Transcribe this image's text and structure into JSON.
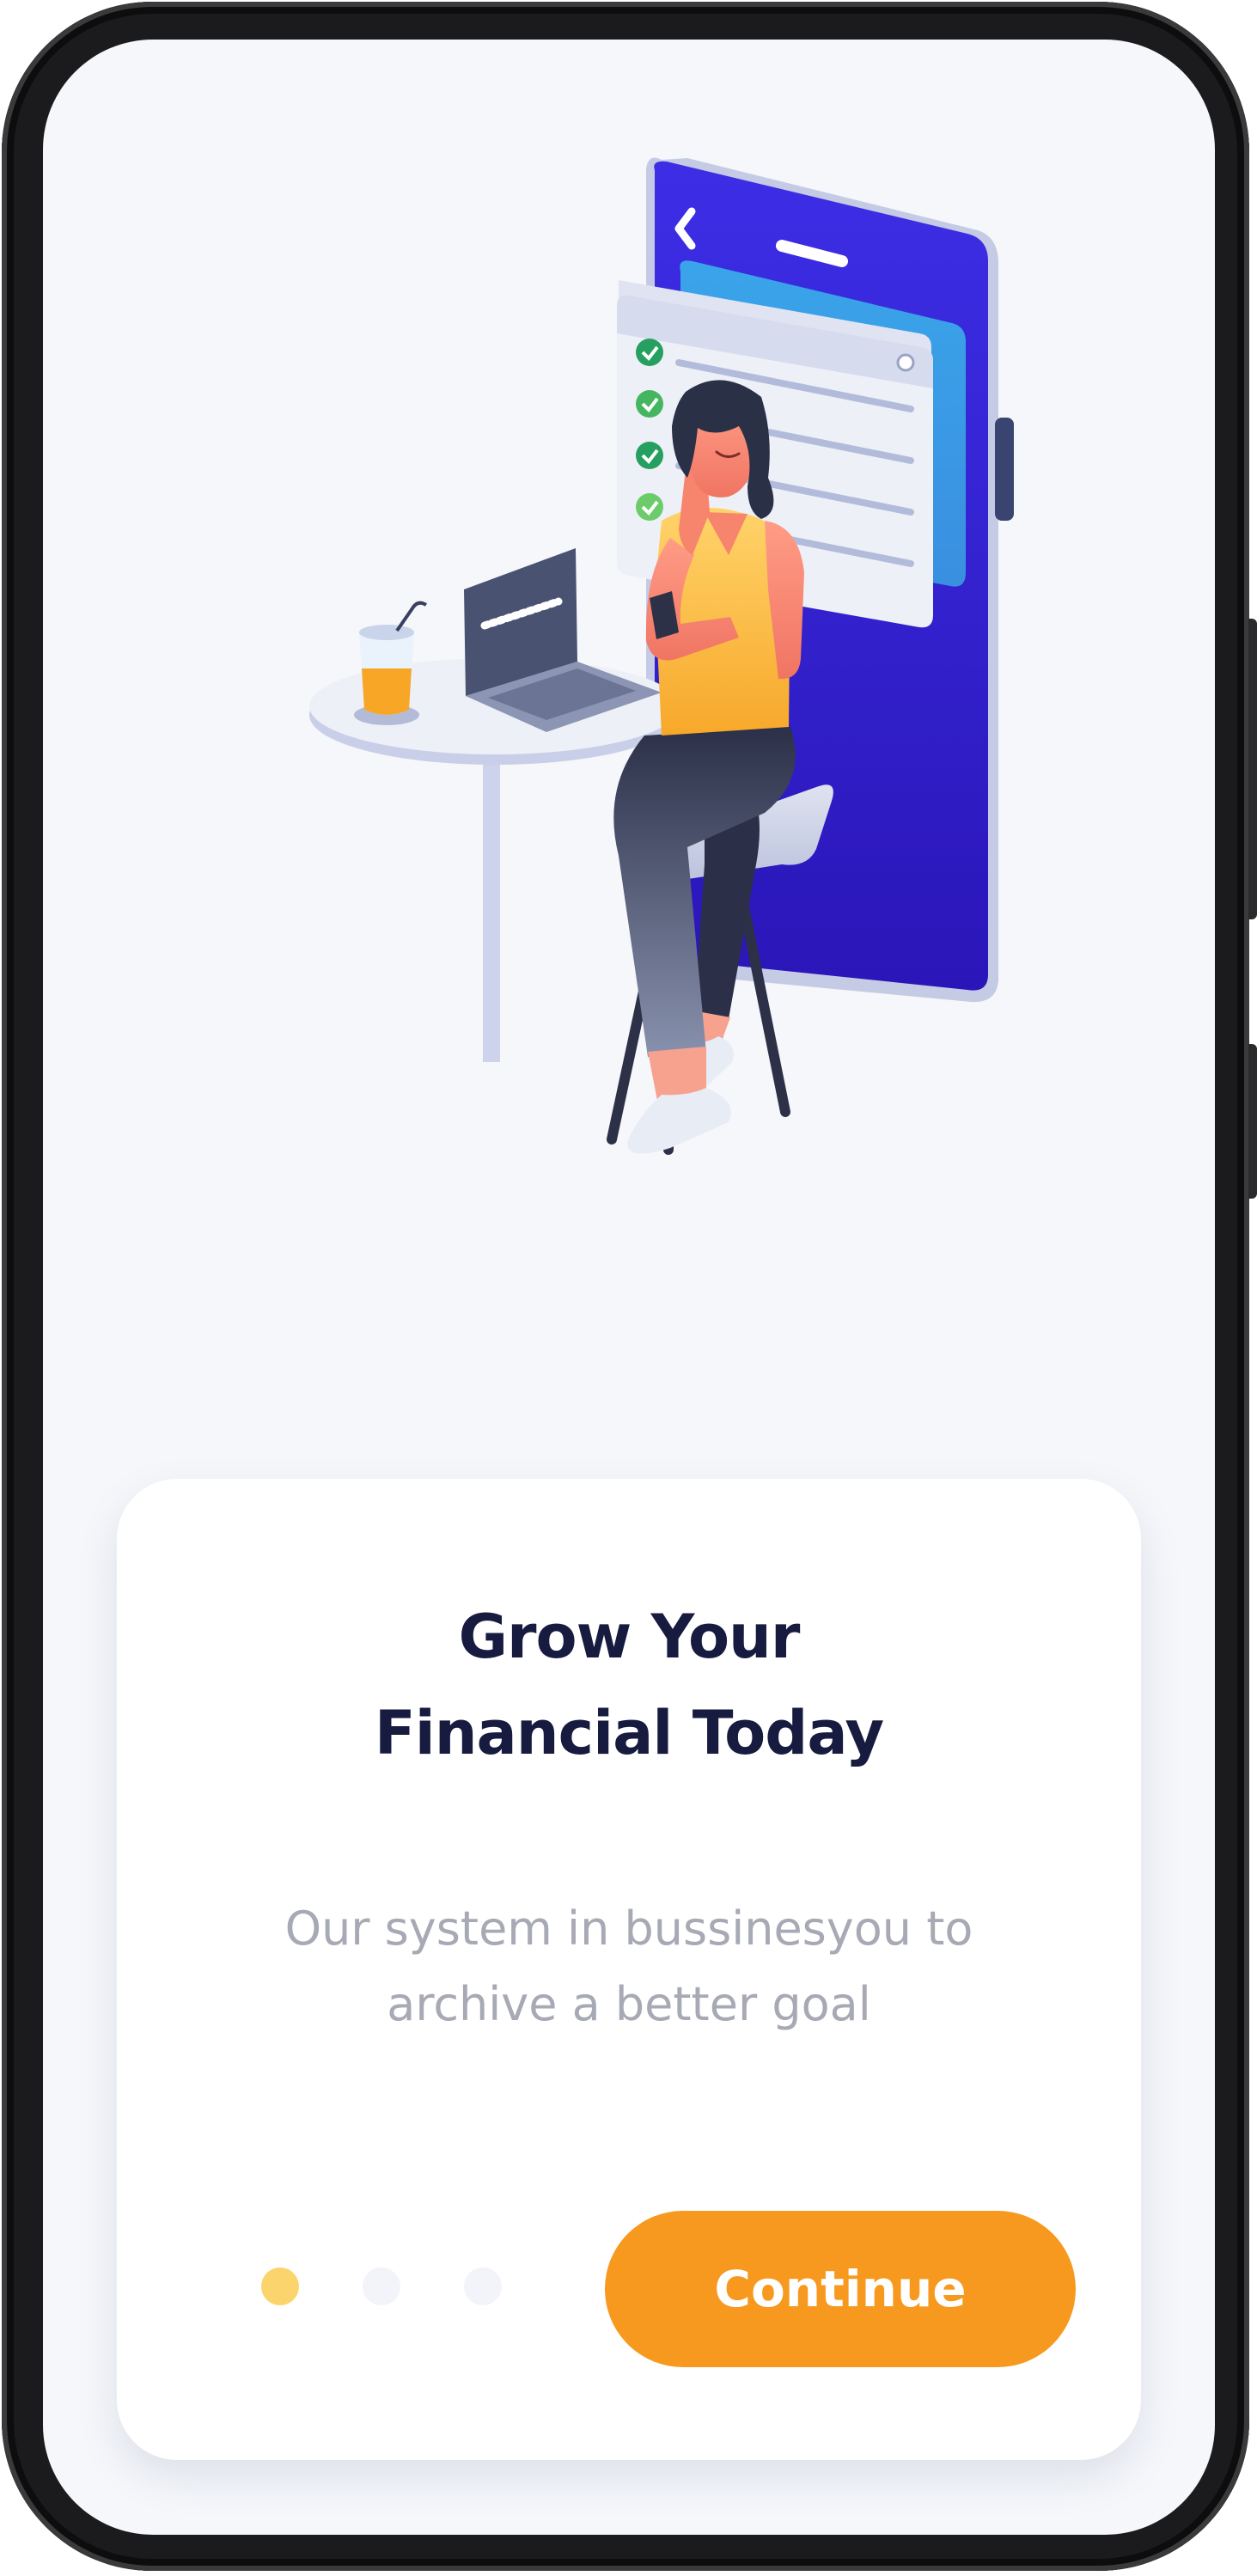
{
  "onboarding": {
    "title_lines": [
      "Grow Your",
      "Financial Today"
    ],
    "description_lines": [
      "Our system in bussinesyou to",
      "archive a better goal"
    ],
    "continue_label": "Continue",
    "page_count": 3,
    "active_page": 1
  },
  "colors": {
    "screen_background": "#f5f7fb",
    "card_background": "#ffffff",
    "title_text": "#171b3f",
    "description_text": "#a7a9b4",
    "accent_button": "#f7991e",
    "dot_active": "#fbd46d",
    "dot_inactive": "#f2f4f9",
    "phone_illustration": "#3a24d8"
  },
  "icons": {
    "illustration": "woman-using-phone-illustration",
    "back": "chevron-left-icon",
    "check": "check-circle-icon"
  }
}
